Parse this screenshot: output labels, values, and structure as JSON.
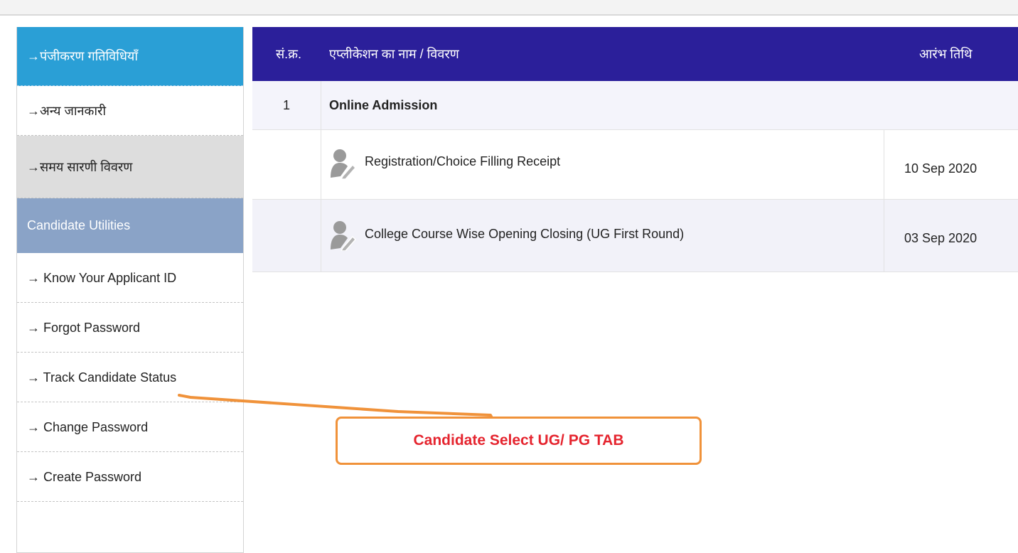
{
  "sidebar": {
    "items": [
      {
        "label": "→पंजीकरण गतिविधियाँ"
      },
      {
        "label": "→अन्य जानकारी"
      },
      {
        "label": "→समय सारणी विवरण"
      },
      {
        "label": "Candidate Utilities"
      },
      {
        "label": "→ Know Your Applicant ID"
      },
      {
        "label": "→ Forgot Password"
      },
      {
        "label": "→ Track Candidate Status"
      },
      {
        "label": "→ Change Password"
      },
      {
        "label": "→ Create Password"
      }
    ]
  },
  "table": {
    "headers": {
      "sn": "सं.क्र.",
      "name": "एप्लीकेशन का नाम / विवरण",
      "start": "आरंभ तिथि"
    },
    "group": {
      "sn": "1",
      "title": "Online Admission"
    },
    "rows": [
      {
        "title": "Registration/Choice Filling Receipt",
        "date": "10 Sep 2020",
        "icon": "user-edit-icon"
      },
      {
        "title": "College Course Wise Opening Closing (UG First Round)",
        "date": "03 Sep 2020",
        "icon": "user-edit-icon"
      }
    ]
  },
  "callout": {
    "text": "Candidate Select UG/ PG TAB"
  },
  "colors": {
    "header_bg": "#2b1f9a",
    "sidebar_active": "#2a9fd6",
    "sidebar_section": "#8aa3c7",
    "callout_border": "#f0923a",
    "callout_text": "#e5252f"
  }
}
